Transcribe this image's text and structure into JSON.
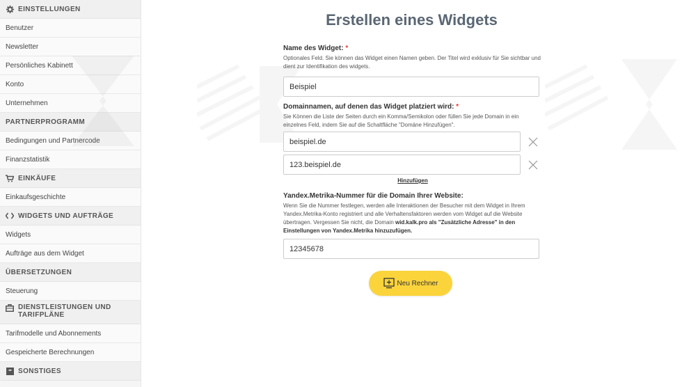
{
  "sidebar": {
    "sections": [
      {
        "title": "EINSTELLUNGEN",
        "icon": "gear-icon",
        "items": [
          "Benutzer",
          "Newsletter",
          "Persönliches Kabinett",
          "Konto",
          "Unternehmen"
        ]
      },
      {
        "title": "PARTNERPROGRAMM",
        "icon": "",
        "items": [
          "Bedingungen und Partnercode",
          "Finanzstatistik"
        ]
      },
      {
        "title": "EINKÄUFE",
        "icon": "cart-icon",
        "items": [
          "Einkaufsgeschichte"
        ]
      },
      {
        "title": "WIDGETS UND AUFTRÄGE",
        "icon": "code-icon",
        "items": [
          "Widgets",
          "Aufträge aus dem Widget"
        ]
      },
      {
        "title": "ÜBERSETZUNGEN",
        "icon": "",
        "items": [
          "Steuerung"
        ]
      },
      {
        "title": "DIENSTLEISTUNGEN UND TARIFPLÄNE",
        "icon": "briefcase-icon",
        "items": [
          "Tarifmodelle und Abonnements",
          "Gespeicherte Berechnungen"
        ]
      },
      {
        "title": "SONSTIGES",
        "icon": "box-icon",
        "items": []
      }
    ]
  },
  "main": {
    "title": "Erstellen eines Widgets",
    "name_field": {
      "label": "Name des Widget:",
      "required": "*",
      "help": "Optionales Feld. Sie können das Widget einen Namen geben. Der Titel wird exklusiv für Sie sichtbar und dient zur Identifikation des widgets.",
      "value": "Beispiel"
    },
    "domains_field": {
      "label": "Domainnamen, auf denen das Widget platziert wird:",
      "required": "*",
      "help": "Sie Können die Liste der Seiten durch ein Komma/Semikolon oder füllen Sie jede Domain in ein einzelnes Feld, indem Sie auf die Schaltfläche \"Domäne Hinzufügen\".",
      "values": [
        "beispiel.de",
        "123.beispiel.de"
      ],
      "add_label": "Hinzufügen"
    },
    "metrika_field": {
      "label": "Yandex.Metrika-Nummer für die Domain Ihrer Website:",
      "help_1": "Wenn Sie die Nummer festlegen, werden alle Interaktionen der Besucher mit dem Widget in Ihrem Yandex.Metrika-Konto registriert und alle Verhaltensfaktoren werden vom Widget auf die Website übertragen. Vergessen Sie nicht, die Domain ",
      "help_bold": "wid.kalk.pro als \"Zusätzliche Adresse\" in den Einstellungen von Yandex.Metrika hinzuzufügen.",
      "value": "12345678"
    },
    "submit_label": "Neu Rechner",
    "accent_color": "#fbd43c"
  }
}
